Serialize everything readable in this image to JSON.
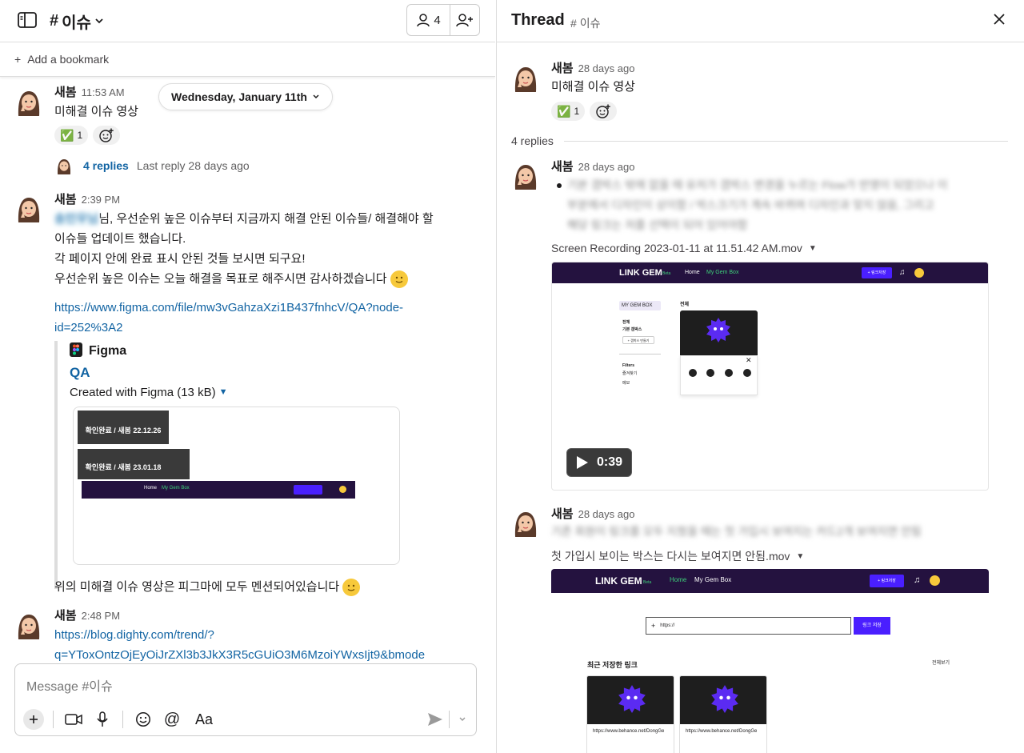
{
  "channel": {
    "name": "이슈",
    "member_count": "4"
  },
  "bookmark": {
    "label": "Add a bookmark"
  },
  "date_divider": "Wednesday, January 11th",
  "messages": [
    {
      "author": "새봄",
      "time": "11:53 AM",
      "text": "미해결 이슈 영상",
      "reaction_emoji": "✅",
      "reaction_count": "1",
      "replies_label": "4 replies",
      "last_reply": "Last reply 28 days ago"
    },
    {
      "author": "새봄",
      "time": "2:39 PM",
      "mention": "송민우님",
      "line1": "님, 우선순위 높은 이슈부터 지금까지 해결 안된 이슈들/ 해결해야 할",
      "line2": "이슈들 업데이트 했습니다.",
      "line3": "각 페이지 안에 완료 표시 안된 것들 보시면 되구요!",
      "line4": "우선순위 높은 이슈는 오늘 해결을 목표로 해주시면 감사하겠습니다",
      "link1": "https://www.figma.com/file/mw3vGahzaXzi1B437fnhcV/QA?node-",
      "link2": "id=252%3A2",
      "figma": {
        "service": "Figma",
        "title": "QA",
        "desc": "Created with Figma (13 kB)",
        "thumb_label1": "확인완료 / 새봄 22.12.26",
        "thumb_label2": "확인완료 / 새봄 23.01.18",
        "thumb_nav_home": "Home",
        "thumb_nav_gem": "My Gem Box"
      },
      "footer": "위의 미해결 이슈 영상은 피그마에 모두 멘션되어있습니다"
    },
    {
      "author": "새봄",
      "time": "2:48 PM",
      "link1": "https://blog.dighty.com/trend/?",
      "link2": "q=YToxOntzOjEyOiJrZXl3b3JkX3R5cGUiO3M6MzoiYWxsIjt9&bmode"
    }
  ],
  "composer": {
    "placeholder": "Message #이슈"
  },
  "thread": {
    "title": "Thread",
    "channel": "이슈",
    "parent": {
      "author": "새봄",
      "time": "28 days ago",
      "text": "미해결 이슈 영상",
      "reaction_emoji": "✅",
      "reaction_count": "1"
    },
    "replies_count": "4 replies",
    "reply1": {
      "author": "새봄",
      "time": "28 days ago",
      "blurred1": "기본 갬박스 밖에 없을 때 유저가 갬박스 변경을 누르는 Flow가 반영이 되었으나 이",
      "blurred2": "부분에서 디자인이 상이함 / 박스크기가 계속 바뀌며 디자인과 맞지 않음, 그리고",
      "blurred3": "해당 링크는 저를 선택이 되어 있어야함",
      "file": "Screen Recording 2023-01-11 at 11.51.42 AM.mov",
      "duration": "0:39",
      "nav_logo": "LINK GEM",
      "nav_beta": "Beta",
      "nav_home": "Home",
      "nav_gem": "My Gem Box",
      "nav_btn": "+ 링크저장",
      "side_box": "MY GEM BOX",
      "side_all": "전체",
      "side_default": "기본 갬박스",
      "side_make": "+ 갬박스 만들기",
      "side_filters": "Filters",
      "side_fav": "즐겨찾기",
      "side_memo": "메모",
      "main_all": "전체"
    },
    "reply2": {
      "author": "새봄",
      "time": "28 days ago",
      "blurred": "기존 회원이 링크를 모두 지웠을 때는 첫 가입시 보여지는 카드2개 보여지면 안됨",
      "file": "첫 가입시 보이는 박스는 다시는 보여지면 안됨.mov",
      "nav_logo": "LINK GEM",
      "nav_beta": "Beta",
      "nav_home": "Home",
      "nav_gem": "My Gem Box",
      "nav_btn": "+ 링크저장",
      "input_ph": "https://",
      "save_btn": "링크 저장",
      "recent": "최근 저장한 링크",
      "view_all": "전체보기",
      "card_url1": "https://www.behance.net/DongGe",
      "card_url2": "https://www.behance.net/DongGe"
    }
  },
  "colors": {
    "link": "#1264a3",
    "nav": "#24123f",
    "accent": "#4a1fff",
    "green": "#2eb67d"
  }
}
